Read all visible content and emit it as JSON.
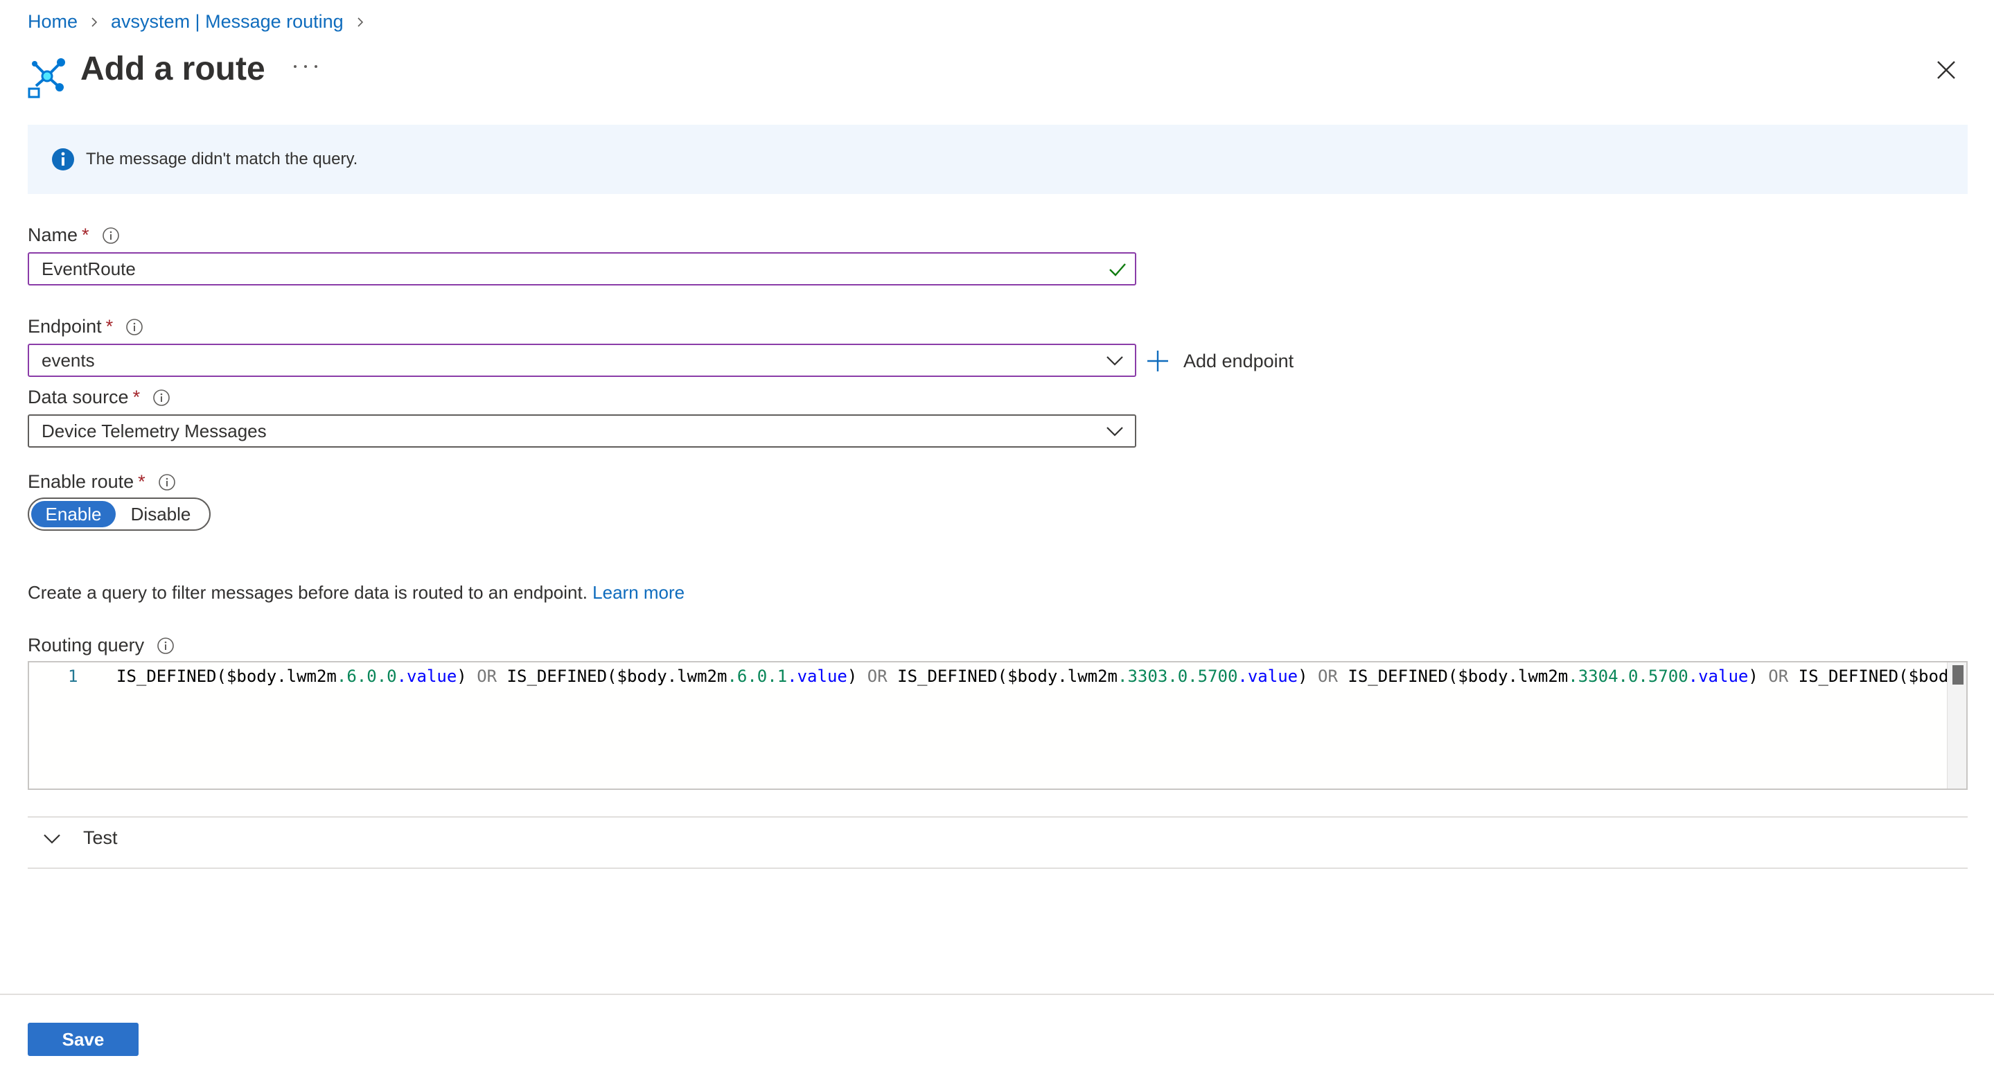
{
  "breadcrumb": [
    {
      "label": "Home"
    },
    {
      "label": "avsystem | Message routing"
    }
  ],
  "page": {
    "title": "Add a route",
    "more_label": "..."
  },
  "info_message": "The message didn't match the query.",
  "form": {
    "name": {
      "label": "Name",
      "required": "*",
      "value": "EventRoute"
    },
    "endpoint": {
      "label": "Endpoint",
      "required": "*",
      "value": "events",
      "add_label": "Add endpoint"
    },
    "data_source": {
      "label": "Data source",
      "required": "*",
      "value": "Device Telemetry Messages"
    },
    "enable_route": {
      "label": "Enable route",
      "required": "*",
      "options": [
        "Enable",
        "Disable"
      ],
      "selected": "Enable"
    }
  },
  "query": {
    "description": "Create a query to filter messages before data is routed to an endpoint.",
    "learn_more": "Learn more",
    "label": "Routing query",
    "line_number": "1",
    "tokens": [
      {
        "t": "IS_DEFINED($body.lwm2m",
        "c": "plain"
      },
      {
        "t": ".6.0.0",
        "c": "num"
      },
      {
        "t": ".value",
        "c": "val"
      },
      {
        "t": ") ",
        "c": "plain"
      },
      {
        "t": "OR",
        "c": "op"
      },
      {
        "t": " IS_DEFINED($body.lwm2m",
        "c": "plain"
      },
      {
        "t": ".6.0.1",
        "c": "num"
      },
      {
        "t": ".value",
        "c": "val"
      },
      {
        "t": ") ",
        "c": "plain"
      },
      {
        "t": "OR",
        "c": "op"
      },
      {
        "t": " IS_DEFINED($body.lwm2m",
        "c": "plain"
      },
      {
        "t": ".3303.0.5700",
        "c": "num"
      },
      {
        "t": ".value",
        "c": "val"
      },
      {
        "t": ") ",
        "c": "plain"
      },
      {
        "t": "OR",
        "c": "op"
      },
      {
        "t": " IS_DEFINED($body.lwm2m",
        "c": "plain"
      },
      {
        "t": ".3304.0.5700",
        "c": "num"
      },
      {
        "t": ".value",
        "c": "val"
      },
      {
        "t": ") ",
        "c": "plain"
      },
      {
        "t": "OR",
        "c": "op"
      },
      {
        "t": " IS_DEFINED($bod",
        "c": "plain"
      }
    ]
  },
  "test_section": {
    "label": "Test"
  },
  "footer": {
    "save_label": "Save"
  },
  "colors": {
    "accent": "#2b71c9",
    "link": "#0f6cbd",
    "required": "#a4262c",
    "active_border": "#8a3ca8",
    "info_bg": "#f0f6fd",
    "success": "#107c10"
  },
  "icons": {
    "title": "route-icon",
    "info": "info-icon",
    "close": "close-icon",
    "check": "check-icon",
    "chevron": "chevron-down-icon",
    "plus": "plus-icon"
  }
}
